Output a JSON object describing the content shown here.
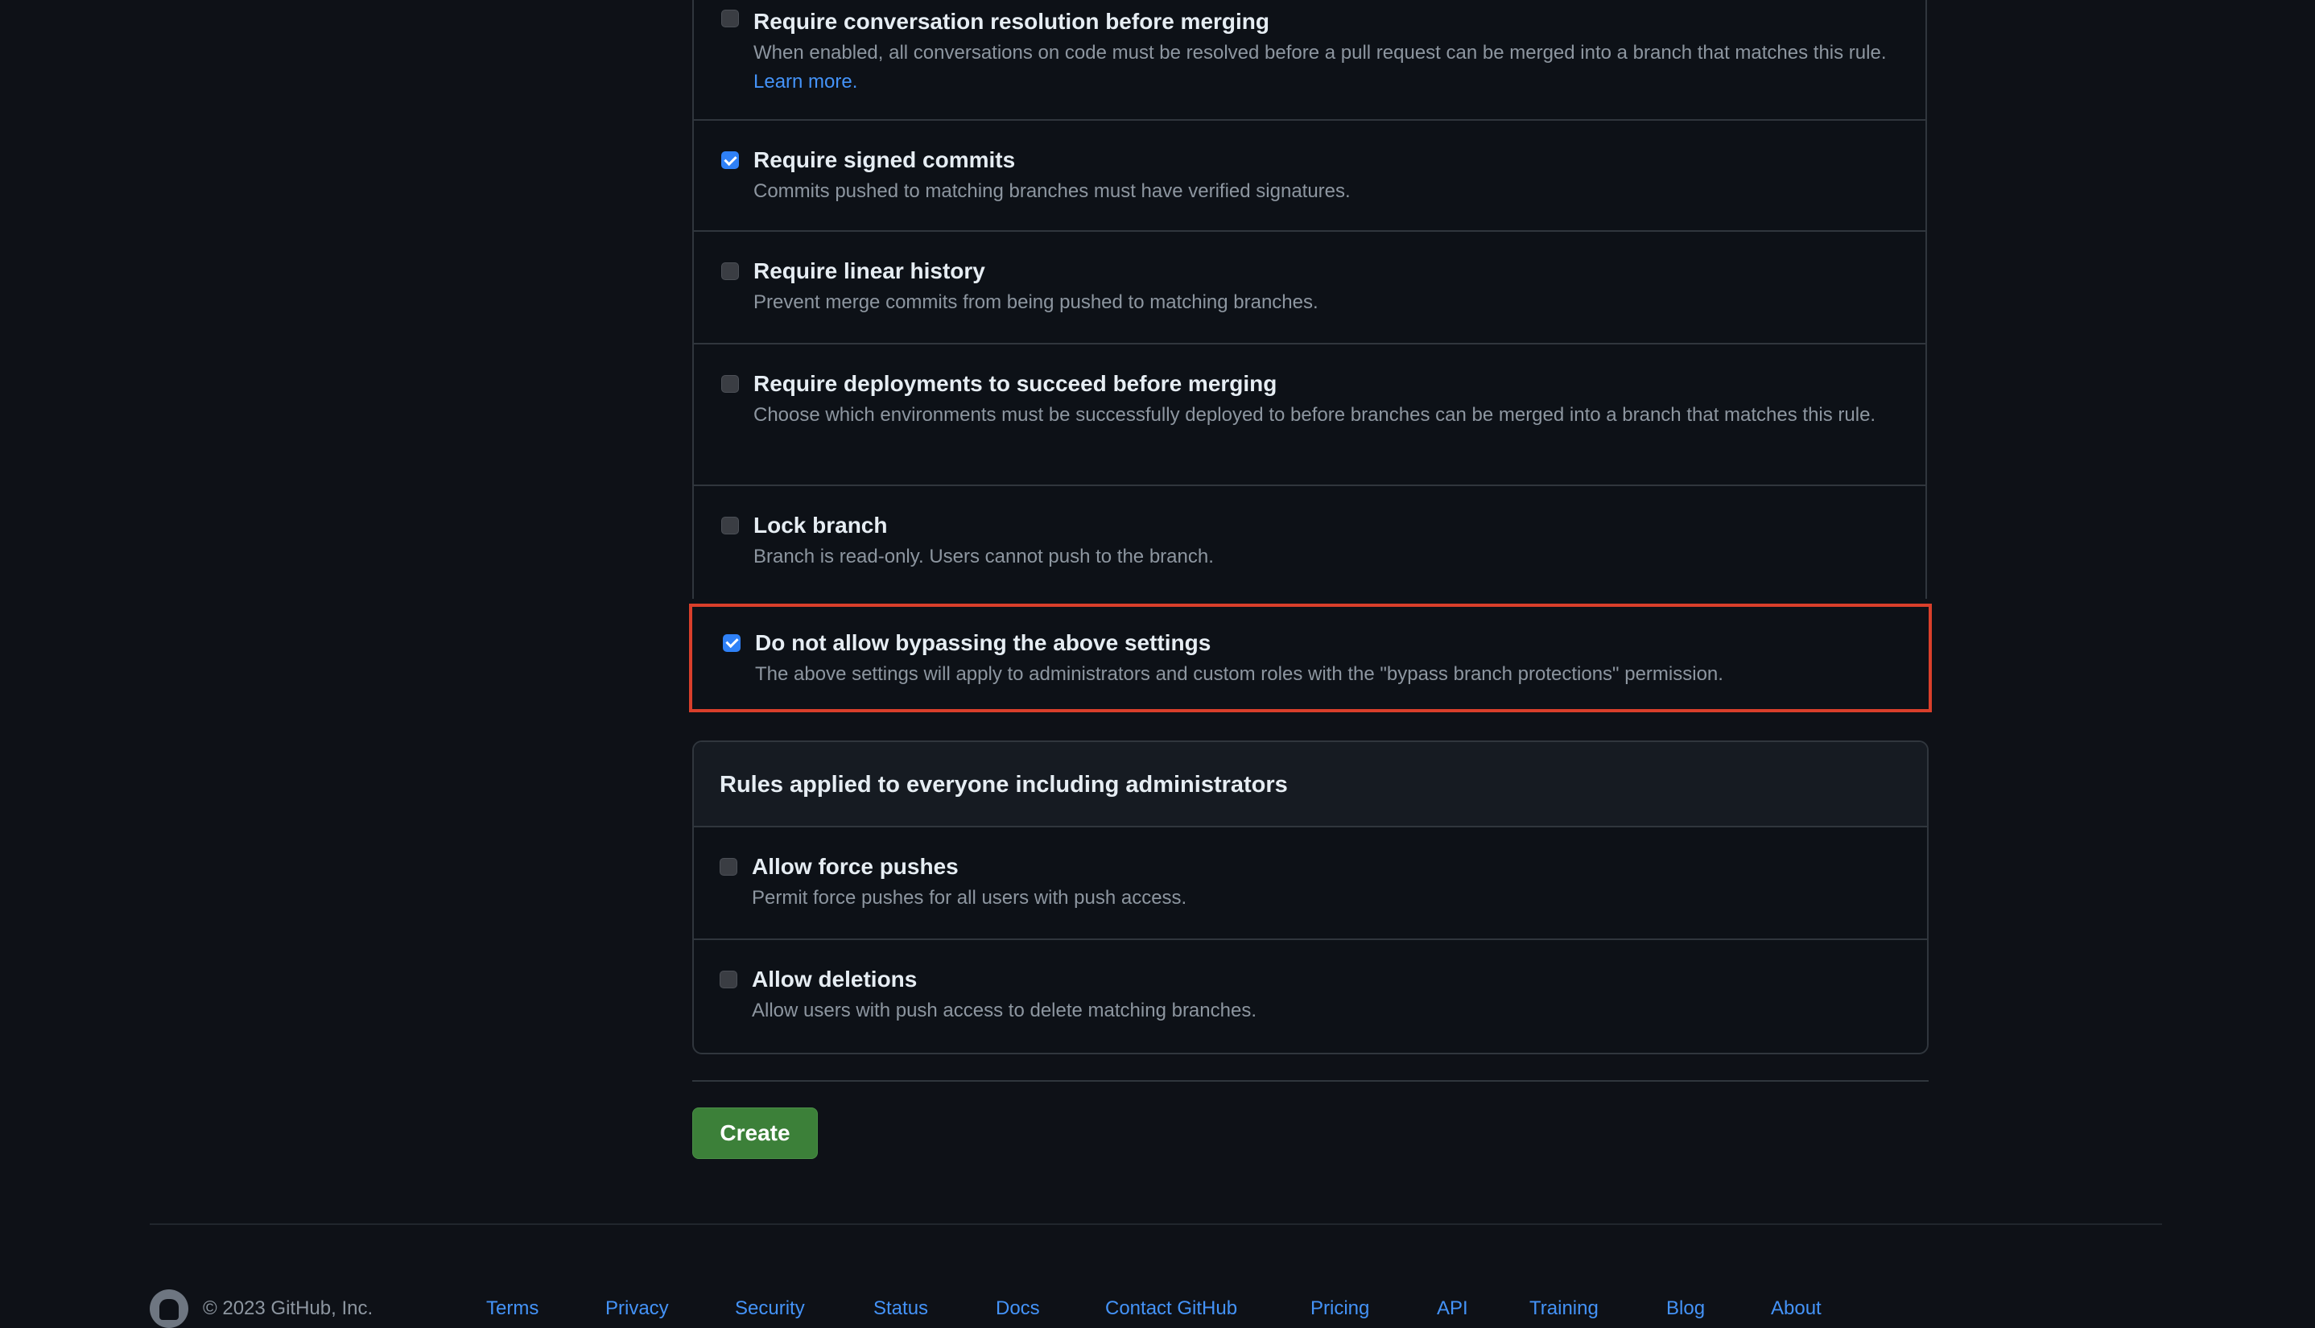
{
  "rules_section": {
    "items": [
      {
        "title": "Require conversation resolution before merging",
        "description": "When enabled, all conversations on code must be resolved before a pull request can be merged into a branch that matches this rule.",
        "link": "Learn more.",
        "checked": false
      },
      {
        "title": "Require signed commits",
        "description": "Commits pushed to matching branches must have verified signatures.",
        "checked": true
      },
      {
        "title": "Require linear history",
        "description": "Prevent merge commits from being pushed to matching branches.",
        "checked": false
      },
      {
        "title": "Require deployments to succeed before merging",
        "description": "Choose which environments must be successfully deployed to before branches can be merged into a branch that matches this rule.",
        "checked": false
      },
      {
        "title": "Lock branch",
        "description": "Branch is read-only. Users cannot push to the branch.",
        "checked": false
      },
      {
        "title": "Do not allow bypassing the above settings",
        "description": "The above settings will apply to administrators and custom roles with the \"bypass branch protections\" permission.",
        "checked": true,
        "highlighted": true
      }
    ]
  },
  "everyone_section": {
    "header": "Rules applied to everyone including administrators",
    "items": [
      {
        "title": "Allow force pushes",
        "description": "Permit force pushes for all users with push access.",
        "checked": false
      },
      {
        "title": "Allow deletions",
        "description": "Allow users with push access to delete matching branches.",
        "checked": false
      }
    ]
  },
  "actions": {
    "create_label": "Create"
  },
  "footer": {
    "copyright": "© 2023 GitHub, Inc.",
    "links": [
      "Terms",
      "Privacy",
      "Security",
      "Status",
      "Docs",
      "Contact GitHub",
      "Pricing",
      "API",
      "Training",
      "Blog",
      "About"
    ]
  },
  "colors": {
    "accent_link": "#4493f8",
    "checkbox_checked": "#2f81f7",
    "create_button": "#3c8039",
    "highlight_border": "#d93f2b"
  }
}
